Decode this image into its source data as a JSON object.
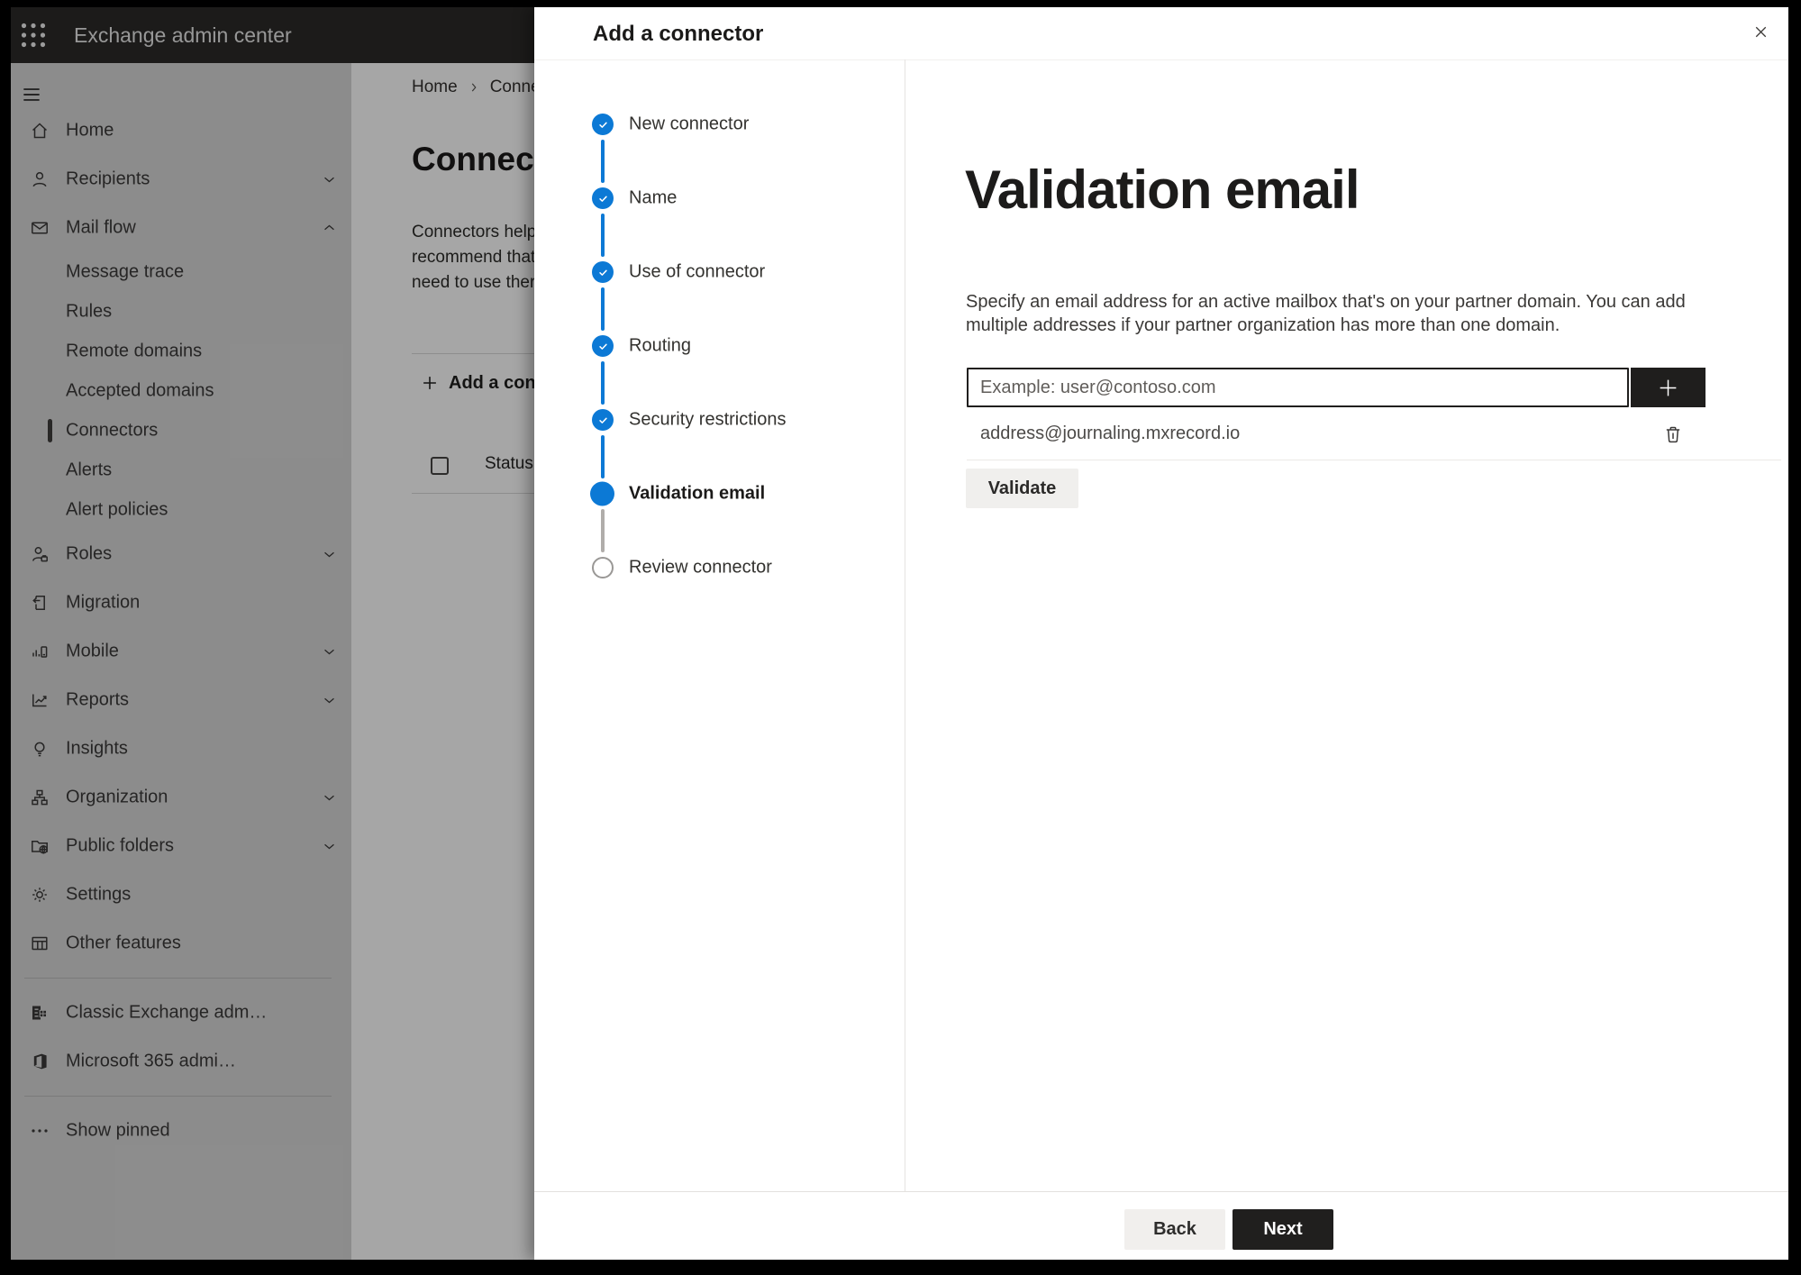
{
  "topbar": {
    "title": "Exchange admin center"
  },
  "sidebar": {
    "items": [
      {
        "label": "Home",
        "icon": "home-icon"
      },
      {
        "label": "Recipients",
        "icon": "recipients-icon",
        "chevron": "down"
      },
      {
        "label": "Mail flow",
        "icon": "mail-flow-icon",
        "chevron": "up"
      },
      {
        "label": "Message trace",
        "sub": true
      },
      {
        "label": "Rules",
        "sub": true
      },
      {
        "label": "Remote domains",
        "sub": true
      },
      {
        "label": "Accepted domains",
        "sub": true
      },
      {
        "label": "Connectors",
        "sub": true,
        "selected": true
      },
      {
        "label": "Alerts",
        "sub": true
      },
      {
        "label": "Alert policies",
        "sub": true
      },
      {
        "label": "Roles",
        "icon": "roles-icon",
        "chevron": "down"
      },
      {
        "label": "Migration",
        "icon": "migration-icon"
      },
      {
        "label": "Mobile",
        "icon": "mobile-icon",
        "chevron": "down"
      },
      {
        "label": "Reports",
        "icon": "reports-icon",
        "chevron": "down"
      },
      {
        "label": "Insights",
        "icon": "insights-icon"
      },
      {
        "label": "Organization",
        "icon": "organization-icon",
        "chevron": "down"
      },
      {
        "label": "Public folders",
        "icon": "public-folders-icon",
        "chevron": "down"
      },
      {
        "label": "Settings",
        "icon": "settings-icon"
      },
      {
        "label": "Other features",
        "icon": "other-features-icon"
      },
      {
        "label": "Classic Exchange adm…",
        "icon": "classic-exchange-icon"
      },
      {
        "label": "Microsoft 365 admi…",
        "icon": "microsoft-365-icon"
      },
      {
        "label": "Show pinned",
        "icon": "more-icon"
      }
    ]
  },
  "content": {
    "breadcrumb": {
      "home": "Home",
      "current": "Connectors"
    },
    "title": "Connectors",
    "body_line1": "Connectors help",
    "body_line2": "recommend that",
    "body_line3": "need to use ther",
    "add_button": "Add a connector",
    "table": {
      "status_column": "Status"
    }
  },
  "panel": {
    "title": "Add a connector",
    "steps": [
      {
        "label": "New connector",
        "state": "done"
      },
      {
        "label": "Name",
        "state": "done"
      },
      {
        "label": "Use of connector",
        "state": "done"
      },
      {
        "label": "Routing",
        "state": "done"
      },
      {
        "label": "Security restrictions",
        "state": "done"
      },
      {
        "label": "Validation email",
        "state": "current"
      },
      {
        "label": "Review connector",
        "state": "todo"
      }
    ],
    "page": {
      "heading": "Validation email",
      "description_line1": "Specify an email address for an active mailbox that's on your partner domain. You can add",
      "description_line2": "multiple addresses if your partner organization has more than one domain.",
      "email_placeholder": "Example: user@contoso.com",
      "added_address": "address@journaling.mxrecord.io",
      "validate_button": "Validate"
    },
    "footer": {
      "back_button": "Back",
      "next_button": "Next"
    }
  },
  "colors": {
    "accent": "#0078d4",
    "dark_button": "#1f1e1d",
    "overlay": "rgba(0,0,0,0.35)"
  }
}
